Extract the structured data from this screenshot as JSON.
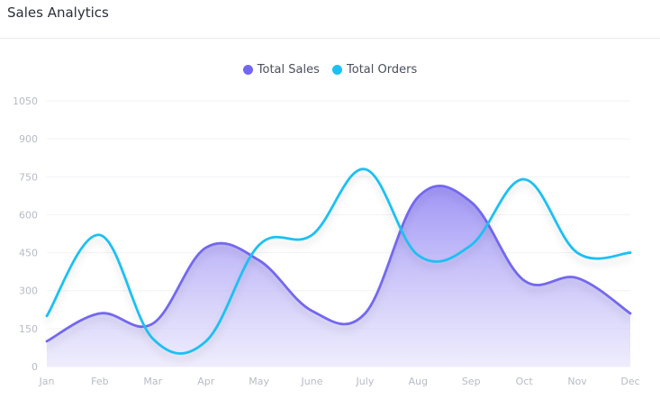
{
  "header": {
    "title": "Sales Analytics"
  },
  "colors": {
    "sales": "#7367f0",
    "orders": "#1ec0f2",
    "sales_fill_top": "#9a8ff5",
    "sales_fill_bottom": "#e7e4fb",
    "grid": "#f1f2f5"
  },
  "chart_data": {
    "type": "line",
    "categories": [
      "Jan",
      "Feb",
      "Mar",
      "Apr",
      "May",
      "June",
      "July",
      "Aug",
      "Sep",
      "Oct",
      "Nov",
      "Dec"
    ],
    "series": [
      {
        "name": "Total Sales",
        "values": [
          100,
          210,
          170,
          470,
          420,
          220,
          210,
          670,
          650,
          340,
          350,
          210
        ],
        "style": "area"
      },
      {
        "name": "Total Orders",
        "values": [
          200,
          520,
          110,
          100,
          480,
          520,
          780,
          440,
          480,
          740,
          450,
          450
        ],
        "style": "line"
      }
    ],
    "yticks": [
      "0",
      "150",
      "300",
      "450",
      "600",
      "750",
      "900",
      "1050"
    ],
    "ylim": [
      0,
      1050
    ],
    "legend_position": "top-center",
    "grid": true
  }
}
